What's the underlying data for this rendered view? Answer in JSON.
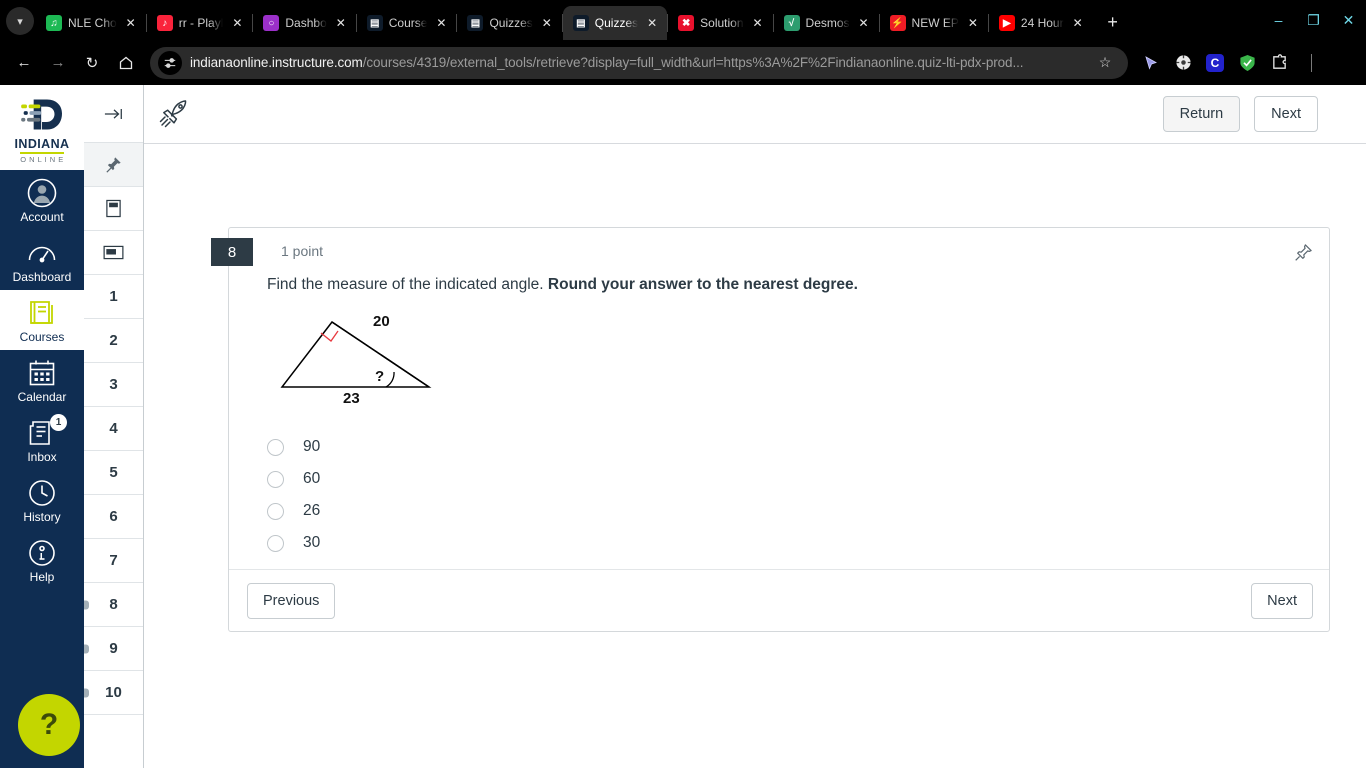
{
  "browser": {
    "tab_list_icon": "chevron-down-icon",
    "tabs": [
      {
        "title": "NLE Cho",
        "favicon": "spotify-icon",
        "favicon_color": "#1db954",
        "glyph": "♫",
        "active": false
      },
      {
        "title": "rr - Playl",
        "favicon": "music-icon",
        "favicon_color": "#fa233b",
        "glyph": "♪",
        "active": false
      },
      {
        "title": "Dashbo",
        "favicon": "bulb-icon",
        "favicon_color": "#9b30c9",
        "glyph": "○",
        "active": false
      },
      {
        "title": "Course ",
        "favicon": "canvas-icon",
        "favicon_color": "#0e1b2a",
        "glyph": "▤",
        "active": false
      },
      {
        "title": "Quizzes",
        "favicon": "canvas-icon",
        "favicon_color": "#0e1b2a",
        "glyph": "▤",
        "active": false
      },
      {
        "title": "Quizzes",
        "favicon": "canvas-icon",
        "favicon_color": "#0e1b2a",
        "glyph": "▤",
        "active": true
      },
      {
        "title": "Solution",
        "favicon": "x-icon",
        "favicon_color": "#e8112d",
        "glyph": "✖",
        "active": false
      },
      {
        "title": "Desmos",
        "favicon": "desmos-icon",
        "favicon_color": "#2d9d6f",
        "glyph": "√",
        "active": false
      },
      {
        "title": "NEW EP",
        "favicon": "bolt-icon",
        "favicon_color": "#ee1c25",
        "glyph": "⚡",
        "active": false
      },
      {
        "title": "24 Hour",
        "favicon": "youtube-icon",
        "favicon_color": "#ff0000",
        "glyph": "▶",
        "active": false
      }
    ],
    "new_tab_label": "+",
    "window_controls": {
      "minimize": "–",
      "maximize": "❐",
      "close": "✕"
    },
    "nav": {
      "back": "←",
      "forward": "→",
      "reload": "↻",
      "home": "⌂"
    },
    "url": {
      "host": "indianaonline.instructure.com",
      "path": "/courses/4319/external_tools/retrieve?display=full_width&url=https%3A%2F%2Findianaonline.quiz-lti-pdx-prod..."
    },
    "bookmark_icon": "star-icon",
    "toolbar_icons": [
      {
        "name": "cursor-icon",
        "glyph": "➤",
        "color": "#8f8fe8"
      },
      {
        "name": "globe-icon",
        "glyph": "⊕",
        "color": "#e6e6e6"
      },
      {
        "name": "extension-c-icon",
        "glyph": "C",
        "color": "#ffffff",
        "bg": "#2222cc"
      },
      {
        "name": "shield-check-icon",
        "glyph": "✓",
        "color": "#ffffff",
        "bg": "#3ab54a"
      },
      {
        "name": "puzzle-icon",
        "glyph": "⧉",
        "color": "#e6e6e6"
      },
      {
        "name": "menu-kebab-icon",
        "glyph": "⋮",
        "color": "#e6e6e6"
      }
    ]
  },
  "global_nav": {
    "logo": {
      "line1": "INDIANA",
      "line2": "O N L I N E"
    },
    "items": [
      {
        "label": "Account",
        "icon": "account-avatar-icon",
        "active": false,
        "badge": null
      },
      {
        "label": "Dashboard",
        "icon": "dashboard-gauge-icon",
        "active": false,
        "badge": null
      },
      {
        "label": "Courses",
        "icon": "courses-book-icon",
        "active": true,
        "badge": null
      },
      {
        "label": "Calendar",
        "icon": "calendar-icon",
        "active": false,
        "badge": null
      },
      {
        "label": "Inbox",
        "icon": "inbox-icon",
        "active": false,
        "badge": "1"
      },
      {
        "label": "History",
        "icon": "clock-icon",
        "active": false,
        "badge": null
      },
      {
        "label": "Help",
        "icon": "help-info-icon",
        "active": false,
        "badge": null
      }
    ],
    "help_bubble": "?"
  },
  "quiz_rail": {
    "collapse_icon": "collapse-panel-icon",
    "tools": [
      {
        "name": "pin-tool",
        "icon": "pushpin-icon",
        "pinned": true
      },
      {
        "name": "notes-tool",
        "icon": "note-card-icon",
        "pinned": false
      },
      {
        "name": "calculator-tool",
        "icon": "display-box-icon",
        "pinned": false
      }
    ],
    "questions": [
      {
        "number": "1",
        "flagged": false
      },
      {
        "number": "2",
        "flagged": false
      },
      {
        "number": "3",
        "flagged": false
      },
      {
        "number": "4",
        "flagged": false
      },
      {
        "number": "5",
        "flagged": false
      },
      {
        "number": "6",
        "flagged": false
      },
      {
        "number": "7",
        "flagged": false
      },
      {
        "number": "8",
        "flagged": true
      },
      {
        "number": "9",
        "flagged": true
      },
      {
        "number": "10",
        "flagged": true
      }
    ]
  },
  "quiz_header": {
    "rocket_icon": "rocket-icon",
    "return_label": "Return",
    "next_label": "Next"
  },
  "question": {
    "number": "8",
    "points": "1 point",
    "pin_icon": "pushpin-outline-icon",
    "prompt_plain": "Find the measure of the indicated angle. ",
    "prompt_bold": "Round your answer to the nearest degree.",
    "figure": {
      "type": "right-triangle",
      "hypotenuse_label": "20",
      "base_label": "23",
      "angle_label": "?",
      "right_angle_marker_color": "#e8393f",
      "stroke_color": "#000000"
    },
    "answers": [
      {
        "label": "90",
        "selected": false
      },
      {
        "label": "60",
        "selected": false
      },
      {
        "label": "26",
        "selected": false
      },
      {
        "label": "30",
        "selected": false
      }
    ],
    "previous_label": "Previous",
    "next_label": "Next"
  },
  "colors": {
    "canvas_navy": "#0f2d52",
    "question_chip": "#2d3b45",
    "help_green": "#c3d600",
    "text": "#2d3b45"
  }
}
